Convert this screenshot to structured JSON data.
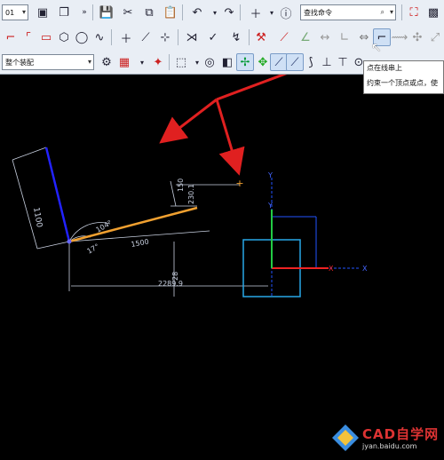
{
  "toolbar": {
    "layer_field": "01",
    "search_field": "查找命令",
    "assembly_field": "整个装配"
  },
  "tooltip": {
    "line1": "点在线串上",
    "line2": "约束一个顶点或点，使"
  },
  "drawing": {
    "dim_1100": "1100",
    "dim_104": "104°",
    "dim_17": "17°",
    "dim_1500": "1500",
    "dim_2289": "2289.9",
    "dim_28": "28",
    "dim_150": "150",
    "dim_230": "230.1",
    "axis_y_label": "Y",
    "axis_x_label": "X"
  },
  "watermark": {
    "text": "CAD自学网",
    "sub": "jyan.baidu.com"
  },
  "colors": {
    "canvas_bg": "#000000",
    "blue_line": "#2222ff",
    "orange_line": "#f0a030",
    "dimension": "#c8d0e0",
    "cyan_box": "#29a7e8",
    "arrow_red": "#e02020"
  }
}
